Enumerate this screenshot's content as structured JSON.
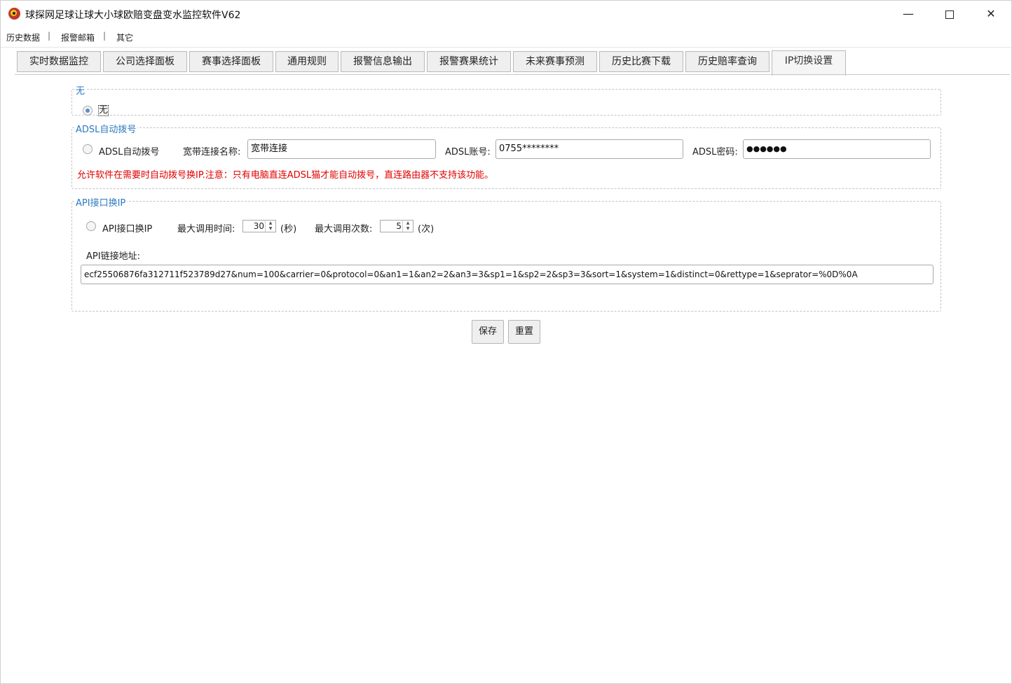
{
  "window": {
    "title": "球探网足球让球大小球欧赔变盘变水监控软件V62",
    "minimize": "—",
    "close": "✕"
  },
  "menu": {
    "items": [
      "历史数据",
      "报警邮箱",
      "其它"
    ],
    "separator": "|"
  },
  "tabs": [
    {
      "label": "实时数据监控"
    },
    {
      "label": "公司选择面板"
    },
    {
      "label": "赛事选择面板"
    },
    {
      "label": "通用规则"
    },
    {
      "label": "报警信息输出"
    },
    {
      "label": "报警赛果统计"
    },
    {
      "label": "未来赛事预测"
    },
    {
      "label": "历史比赛下载"
    },
    {
      "label": "历史赔率查询"
    },
    {
      "label": "IP切换设置",
      "active": true
    }
  ],
  "none_group": {
    "legend": "无",
    "radio_label": "无",
    "selected": true
  },
  "adsl_group": {
    "legend": "ADSL自动拨号",
    "radio_label": "ADSL自动拨号",
    "conn_name_label": "宽带连接名称:",
    "conn_name_value": "宽带连接",
    "account_label": "ADSL账号:",
    "account_value": "0755********",
    "password_label": "ADSL密码:",
    "password_value": "●●●●●●",
    "warning": "允许软件在需要时自动拨号换IP.注意：只有电脑直连ADSL猫才能自动拨号，直连路由器不支持该功能。"
  },
  "api_group": {
    "legend": "API接口换IP",
    "radio_label": "API接口换IP",
    "max_time_label": "最大调用时间:",
    "max_time_value": "30",
    "max_time_unit": "(秒)",
    "max_count_label": "最大调用次数:",
    "max_count_value": "5",
    "max_count_unit": "(次)",
    "url_label": "API链接地址:",
    "url_value": "ecf25506876fa312711f523789d27&num=100&carrier=0&protocol=0&an1=1&an2=2&an3=3&sp1=1&sp2=2&sp3=3&sort=1&system=1&distinct=0&rettype=1&seprator=%0D%0A"
  },
  "actions": {
    "save": "保存",
    "reset": "重置"
  },
  "colors": {
    "accent": "#2d7ac0",
    "warning": "#e00000"
  }
}
